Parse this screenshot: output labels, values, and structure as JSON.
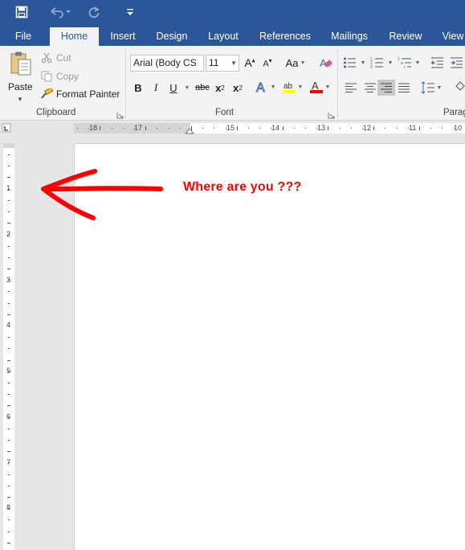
{
  "quick_access": {
    "save_icon": "save-icon",
    "undo_icon": "undo-icon",
    "redo_icon": "redo-icon",
    "customize_icon": "customize-qat-icon"
  },
  "tabs": [
    {
      "label": "File"
    },
    {
      "label": "Home"
    },
    {
      "label": "Insert"
    },
    {
      "label": "Design"
    },
    {
      "label": "Layout"
    },
    {
      "label": "References"
    },
    {
      "label": "Mailings"
    },
    {
      "label": "Review"
    },
    {
      "label": "View"
    }
  ],
  "ribbon": {
    "clipboard": {
      "paste_label": "Paste",
      "cut_label": "Cut",
      "copy_label": "Copy",
      "format_painter_label": "Format Painter",
      "group_label": "Clipboard"
    },
    "font": {
      "font_name": "Arial (Body CS",
      "font_size": "11",
      "bold": "B",
      "italic": "I",
      "underline": "U",
      "strikethrough": "abc",
      "subscript": "x",
      "superscript": "x",
      "change_case": "Aa",
      "group_label": "Font",
      "highlight_color": "#ffff00",
      "font_color": "#ff0000"
    },
    "paragraph": {
      "group_label": "Paragraph"
    }
  },
  "rulers": {
    "horizontal_labels": [
      "18",
      "17",
      "15",
      "14",
      "13",
      "12",
      "11",
      "10"
    ],
    "vertical_labels": [
      "1",
      "2",
      "3",
      "4",
      "5",
      "6",
      "7",
      "8"
    ]
  },
  "annotation": {
    "text": "Where are you ???",
    "color": "#ff0000"
  },
  "colors": {
    "brand": "#2b579a",
    "ribbon_bg": "#f3f3f3",
    "workspace_bg": "#e6e6e6"
  }
}
